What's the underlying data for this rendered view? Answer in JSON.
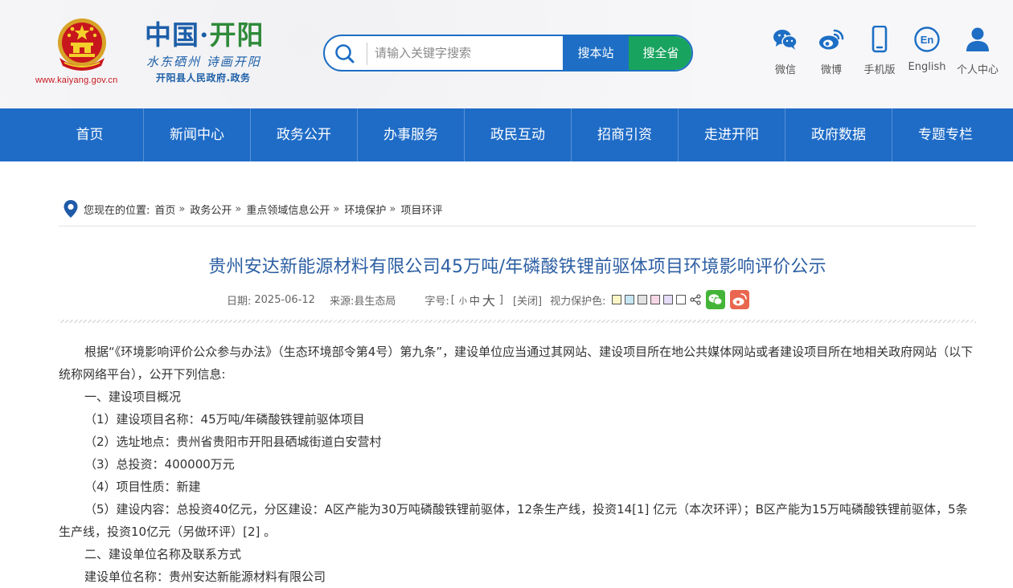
{
  "header": {
    "site_url": "www.kaiyang.gov.cn",
    "brand_main_1": "中国·",
    "brand_main_2": "开阳",
    "slogan": "水东硒州 诗画开阳",
    "subtitle": "开阳县人民政府.政务"
  },
  "search": {
    "placeholder": "请输入关键字搜索",
    "btn_site": "搜本站",
    "btn_province": "搜全省"
  },
  "tools": [
    {
      "label": "微信",
      "icon": "wechat-icon"
    },
    {
      "label": "微博",
      "icon": "weibo-icon"
    },
    {
      "label": "手机版",
      "icon": "mobile-icon"
    },
    {
      "label": "English",
      "icon": "english-icon"
    },
    {
      "label": "个人中心",
      "icon": "user-icon"
    }
  ],
  "nav": [
    "首页",
    "新闻中心",
    "政务公开",
    "办事服务",
    "政民互动",
    "招商引资",
    "走进开阳",
    "政府数据",
    "专题专栏"
  ],
  "breadcrumb": {
    "prefix": "您现在的位置:",
    "items": [
      "首页",
      "政务公开",
      "重点领域信息公开",
      "环境保护",
      "项目环评"
    ],
    "sep": "»"
  },
  "article": {
    "title": "贵州安达新能源材料有限公司45万吨/年磷酸铁锂前驱体项目环境影响评价公示",
    "date_label": "日期:",
    "date": "2025-06-12",
    "source_label": "来源:",
    "source": "县生态局",
    "font_label": "字号:",
    "font_open": "[",
    "font_small": "小",
    "font_mid": "中",
    "font_big": "大",
    "font_close": "]",
    "close_label": "[关闭]",
    "eye_label": "视力保护色:",
    "swatches": [
      "#fbf6c5",
      "#c6e6f4",
      "#e2e2e2",
      "#f7d7e5",
      "#e5dcf7",
      "#ffffff"
    ],
    "paragraphs": [
      "根据“《环境影响评价公众参与办法》（生态环境部令第4号）第九条”，建设单位应当通过其网站、建设项目所在地公共媒体网站或者建设项目所在地相关政府网站（以下统称网络平台），公开下列信息:",
      "一、建设项目概况",
      "（1）建设项目名称：45万吨/年磷酸铁锂前驱体项目",
      "（2）选址地点：贵州省贵阳市开阳县硒城街道白安营村",
      "（3）总投资：400000万元",
      "（4）项目性质：新建",
      "（5）建设内容：总投资40亿元，分区建设：A区产能为30万吨磷酸铁锂前驱体，12条生产线，投资14[1] 亿元（本次环评）；B区产能为15万吨磷酸铁锂前驱体，5条生产线，投资10亿元（另做环评）[2] 。",
      "二、建设单位名称及联系方式",
      "建设单位名称：贵州安达新能源材料有限公司"
    ]
  },
  "colors": {
    "nav_blue": "#1f6cc7",
    "title_blue": "#2d5fa3",
    "search_green": "#18a35e",
    "url_red": "#c8161d"
  }
}
